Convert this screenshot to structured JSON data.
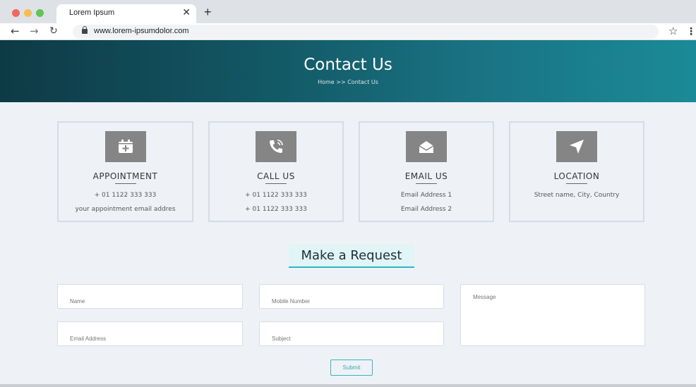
{
  "browser": {
    "tab_title": "Lorem Ipsum",
    "tab_close": "✕",
    "new_tab": "+",
    "back": "←",
    "forward": "→",
    "reload": "↻",
    "url": "www.lorem-ipsumdolor.com",
    "bookmark": "☆",
    "menu": "⋮"
  },
  "hero": {
    "title": "Contact Us",
    "breadcrumb": "Home >> Contact Us"
  },
  "cards": [
    {
      "icon": "calendar-plus-icon",
      "title": "APPOINTMENT",
      "line1": "+ 01 1122 333 333",
      "line2": "your appointment email addres"
    },
    {
      "icon": "phone-icon",
      "title": "CALL US",
      "line1": "+ 01 1122 333 333",
      "line2": "+ 01 1122 333 333"
    },
    {
      "icon": "envelope-open-icon",
      "title": "EMAIL US",
      "line1": "Email Address 1",
      "line2": "Email Address 2"
    },
    {
      "icon": "location-arrow-icon",
      "title": "LOCATION",
      "line1": "Street name, City, Country",
      "line2": ""
    }
  ],
  "request": {
    "title": "Make a Request",
    "name_placeholder": "Name",
    "mobile_placeholder": "Mobile Number",
    "message_placeholder": "Message",
    "email_placeholder": "Email Address",
    "subject_placeholder": "Subject",
    "submit_label": "Submit"
  },
  "colors": {
    "hero_start": "#0e3a45",
    "hero_end": "#1b8a98",
    "accent": "#2cb7c3",
    "icon_tile": "#858585"
  }
}
